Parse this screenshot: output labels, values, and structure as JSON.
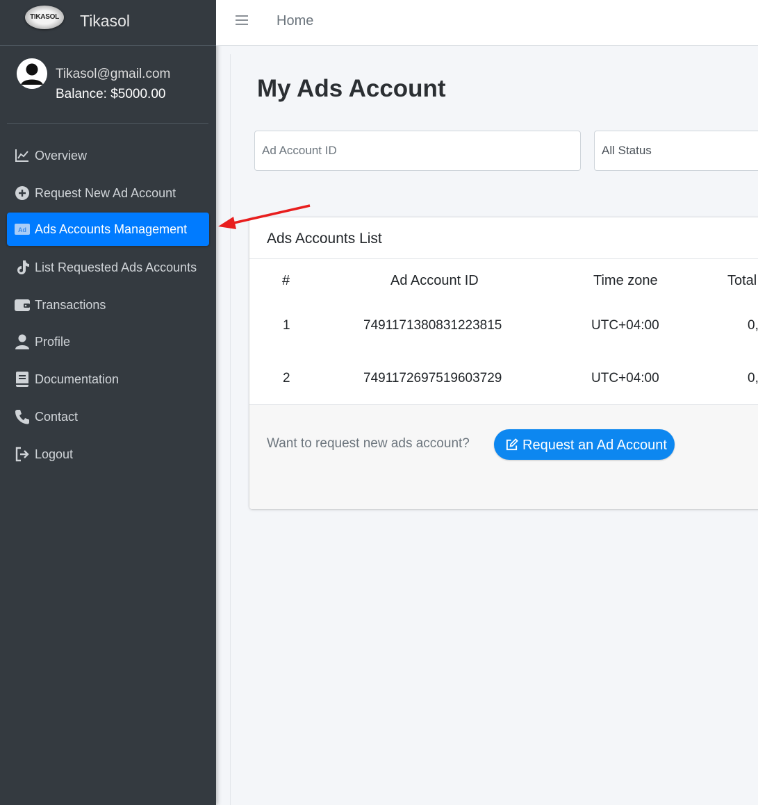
{
  "brand": {
    "logo_text": "TIKASOL",
    "name": "Tikasol"
  },
  "user": {
    "email": "Tikasol@gmail.com",
    "balance": "Balance: $5000.00"
  },
  "sidebar": {
    "items": [
      {
        "label": "Overview",
        "icon": "chart-line-icon"
      },
      {
        "label": "Request New Ad Account",
        "icon": "plus-circle-icon"
      },
      {
        "label": "Ads Accounts Management",
        "icon": "ad-icon",
        "active": true
      },
      {
        "label": "List Requested Ads Accounts",
        "icon": "tiktok-icon"
      },
      {
        "label": "Transactions",
        "icon": "wallet-icon"
      },
      {
        "label": "Profile",
        "icon": "user-icon"
      },
      {
        "label": "Documentation",
        "icon": "book-icon"
      },
      {
        "label": "Contact",
        "icon": "phone-icon"
      },
      {
        "label": "Logout",
        "icon": "sign-out-icon"
      }
    ]
  },
  "topbar": {
    "home": "Home"
  },
  "page": {
    "title": "My Ads Account"
  },
  "filters": {
    "ad_account_placeholder": "Ad Account ID",
    "status_selected": "All Status"
  },
  "table": {
    "title": "Ads Accounts List",
    "headers": [
      "#",
      "Ad Account ID",
      "Time zone",
      "Total"
    ],
    "rows": [
      {
        "num": "1",
        "id": "7491171380831223815",
        "tz": "UTC+04:00",
        "total": "0,"
      },
      {
        "num": "2",
        "id": "7491172697519603729",
        "tz": "UTC+04:00",
        "total": "0,"
      }
    ]
  },
  "footer": {
    "prompt": "Want to request new ads account?",
    "button": "Request an Ad Account"
  },
  "colors": {
    "sidebar_bg": "#343a40",
    "active": "#007bff",
    "button": "#0d87f0",
    "arrow": "#e81e1e"
  }
}
